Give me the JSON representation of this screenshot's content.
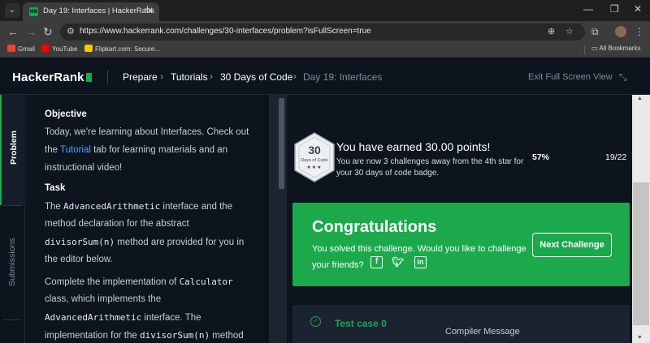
{
  "browser": {
    "tab_title": "Day 19: Interfaces | HackerRank",
    "url": "https://www.hackerrank.com/challenges/30-interfaces/problem?isFullScreen=true",
    "bookmarks": [
      {
        "label": "Gmail",
        "color": "#ea4335"
      },
      {
        "label": "YouTube",
        "color": "#ff0000"
      },
      {
        "label": "Flipkart.com: Secure...",
        "color": "#f7c600"
      }
    ],
    "all_bookmarks": "All Bookmarks"
  },
  "header": {
    "logo": "HackerRank",
    "breadcrumbs": [
      "Prepare",
      "Tutorials",
      "30 Days of Code",
      "Day 19: Interfaces"
    ],
    "exit_fullscreen": "Exit Full Screen View"
  },
  "side_tabs": {
    "problem": "Problem",
    "submissions": "Submissions"
  },
  "problem": {
    "objective_heading": "Objective",
    "objective_line1": "Today, we're learning about Interfaces. Check out",
    "objective_line2_pre": "the ",
    "objective_link": "Tutorial",
    "objective_line2_post": " tab for learning materials and an",
    "objective_line3": "instructional video!",
    "task_heading": "Task",
    "task_l1_pre": "The ",
    "task_l1_code": "AdvancedArithmetic",
    "task_l1_post": " interface and the",
    "task_l2": "method declaration for the abstract",
    "task_l3_code": "divisorSum(n)",
    "task_l3_post": " method are provided for you in",
    "task_l4": "the editor below.",
    "task_l5_pre": "Complete the implementation of ",
    "task_l5_code": "Calculator",
    "task_l6": "class, which implements the",
    "task_l7_code": "AdvancedArithmetic",
    "task_l7_post": " interface. The",
    "task_l8_pre": "implementation for the ",
    "task_l8_code": "divisorSum(n)",
    "task_l8_post": " method"
  },
  "result": {
    "badge_number": "30",
    "badge_label": "Days of Code",
    "badge_stars": "★★★",
    "earned": "You have earned 30.00 points!",
    "away_line1": "You are now 3 challenges away from the 4th star for",
    "away_line2": "your 30 days of code badge.",
    "progress_percent": "57%",
    "progress_count": "19/22",
    "congrats_title": "Congratulations",
    "congrats_line1": "You solved this challenge. Would you like to challenge",
    "congrats_line2": "your friends?",
    "next_challenge": "Next Challenge",
    "test_case": "Test case 0",
    "compiler_message": "Compiler Message"
  },
  "colors": {
    "accent": "#1ba94c",
    "background": "#0e141e",
    "link": "#4aa3ff"
  }
}
